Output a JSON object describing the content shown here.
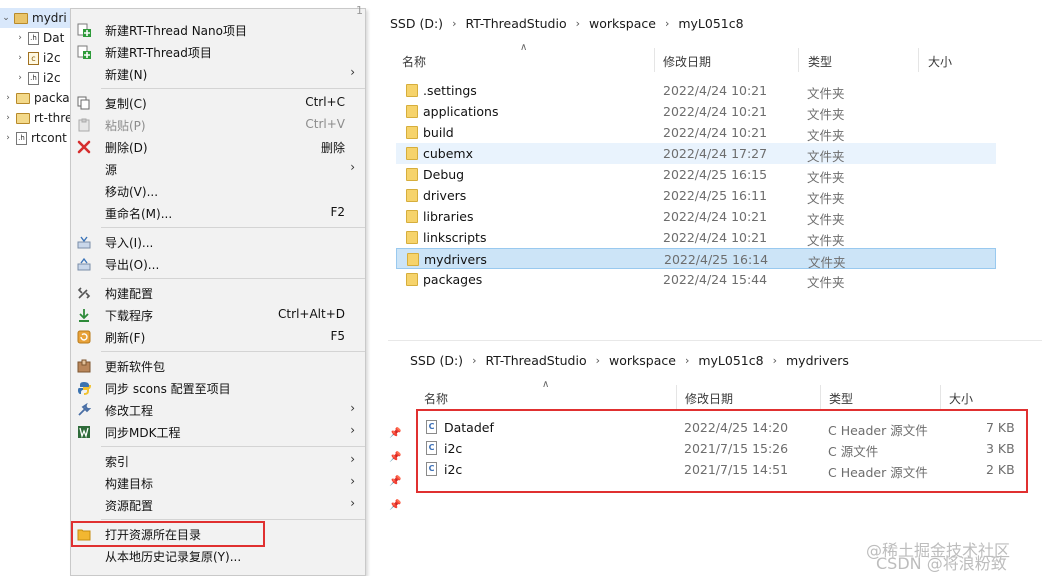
{
  "tree": {
    "items": [
      {
        "label": "mydri",
        "icon": "package-folder-icon",
        "toggle": "expanded"
      },
      {
        "label": "Dat",
        "icon": "h-file-icon",
        "toggle": "collapsed"
      },
      {
        "label": "i2c",
        "icon": "c-file-icon",
        "toggle": "collapsed"
      },
      {
        "label": "i2c",
        "icon": "h-file-icon",
        "toggle": "collapsed"
      },
      {
        "label": "packa",
        "icon": "folder-icon",
        "toggle": "collapsed"
      },
      {
        "label": "rt-thre",
        "icon": "folder-icon",
        "toggle": "collapsed"
      },
      {
        "label": "rtcont",
        "icon": "h-file-icon",
        "toggle": "collapsed"
      }
    ]
  },
  "menu": {
    "items": [
      {
        "label": "新建RT-Thread Nano项目",
        "shortcut": "",
        "submenu": false,
        "icon": "new-project-icon"
      },
      {
        "label": "新建RT-Thread项目",
        "shortcut": "",
        "submenu": false,
        "icon": "new-project-icon"
      },
      {
        "label": "新建(N)",
        "shortcut": "",
        "submenu": true,
        "icon": ""
      },
      {
        "label": "复制(C)",
        "shortcut": "Ctrl+C",
        "submenu": false,
        "icon": "copy-icon"
      },
      {
        "label": "粘贴(P)",
        "shortcut": "Ctrl+V",
        "submenu": false,
        "icon": "paste-icon",
        "disabled": true
      },
      {
        "label": "删除(D)",
        "shortcut": "删除",
        "submenu": false,
        "icon": "delete-icon"
      },
      {
        "label": "源",
        "shortcut": "",
        "submenu": true,
        "icon": ""
      },
      {
        "label": "移动(V)...",
        "shortcut": "",
        "submenu": false,
        "icon": ""
      },
      {
        "label": "重命名(M)...",
        "shortcut": "F2",
        "submenu": false,
        "icon": ""
      },
      {
        "label": "导入(I)...",
        "shortcut": "",
        "submenu": false,
        "icon": "import-icon"
      },
      {
        "label": "导出(O)...",
        "shortcut": "",
        "submenu": false,
        "icon": "export-icon"
      },
      {
        "label": "构建配置",
        "shortcut": "",
        "submenu": false,
        "icon": "build-config-icon"
      },
      {
        "label": "下载程序",
        "shortcut": "Ctrl+Alt+D",
        "submenu": false,
        "icon": "download-icon"
      },
      {
        "label": "刷新(F)",
        "shortcut": "F5",
        "submenu": false,
        "icon": "refresh-icon"
      },
      {
        "label": "更新软件包",
        "shortcut": "",
        "submenu": false,
        "icon": "package-update-icon"
      },
      {
        "label": "同步 scons 配置至项目",
        "shortcut": "",
        "submenu": false,
        "icon": "python-icon"
      },
      {
        "label": "修改工程",
        "shortcut": "",
        "submenu": true,
        "icon": "wrench-icon"
      },
      {
        "label": "同步MDK工程",
        "shortcut": "",
        "submenu": true,
        "icon": "mdk-icon"
      },
      {
        "label": "索引",
        "shortcut": "",
        "submenu": true,
        "icon": ""
      },
      {
        "label": "构建目标",
        "shortcut": "",
        "submenu": true,
        "icon": ""
      },
      {
        "label": "资源配置",
        "shortcut": "",
        "submenu": true,
        "icon": ""
      },
      {
        "label": "打开资源所在目录",
        "shortcut": "",
        "submenu": false,
        "icon": "open-folder-icon"
      },
      {
        "label": "从本地历史记录复原(Y)...",
        "shortcut": "",
        "submenu": false,
        "icon": ""
      }
    ]
  },
  "explorer_top": {
    "breadcrumb": [
      "SSD (D:)",
      "RT-ThreadStudio",
      "workspace",
      "myL051c8"
    ],
    "columns": {
      "name": "名称",
      "date": "修改日期",
      "type": "类型",
      "size": "大小"
    },
    "rows": [
      {
        "name": ".settings",
        "date": "2022/4/24 10:21",
        "type": "文件夹",
        "state": ""
      },
      {
        "name": "applications",
        "date": "2022/4/24 10:21",
        "type": "文件夹",
        "state": ""
      },
      {
        "name": "build",
        "date": "2022/4/24 10:21",
        "type": "文件夹",
        "state": ""
      },
      {
        "name": "cubemx",
        "date": "2022/4/24 17:27",
        "type": "文件夹",
        "state": "hover"
      },
      {
        "name": "Debug",
        "date": "2022/4/25 16:15",
        "type": "文件夹",
        "state": ""
      },
      {
        "name": "drivers",
        "date": "2022/4/25 16:11",
        "type": "文件夹",
        "state": ""
      },
      {
        "name": "libraries",
        "date": "2022/4/24 10:21",
        "type": "文件夹",
        "state": ""
      },
      {
        "name": "linkscripts",
        "date": "2022/4/24 10:21",
        "type": "文件夹",
        "state": ""
      },
      {
        "name": "mydrivers",
        "date": "2022/4/25 16:14",
        "type": "文件夹",
        "state": "selected"
      },
      {
        "name": "packages",
        "date": "2022/4/24 15:44",
        "type": "文件夹",
        "state": ""
      }
    ]
  },
  "explorer_bottom": {
    "breadcrumb": [
      "SSD (D:)",
      "RT-ThreadStudio",
      "workspace",
      "myL051c8",
      "mydrivers"
    ],
    "columns": {
      "name": "名称",
      "date": "修改日期",
      "type": "类型",
      "size": "大小"
    },
    "rows": [
      {
        "name": "Datadef",
        "date": "2022/4/25 14:20",
        "type": "C Header 源文件",
        "size": "7 KB"
      },
      {
        "name": "i2c",
        "date": "2021/7/15 15:26",
        "type": "C 源文件",
        "size": "3 KB"
      },
      {
        "name": "i2c",
        "date": "2021/7/15 14:51",
        "type": "C Header 源文件",
        "size": "2 KB"
      }
    ]
  },
  "watermarks": {
    "line1": "@稀土掘金技术社区",
    "line2": "CSDN @将浪粉致"
  },
  "colors": {
    "highlight_box": "#e03030",
    "selection": "#cce4f7",
    "folder": "#f6d36b"
  }
}
